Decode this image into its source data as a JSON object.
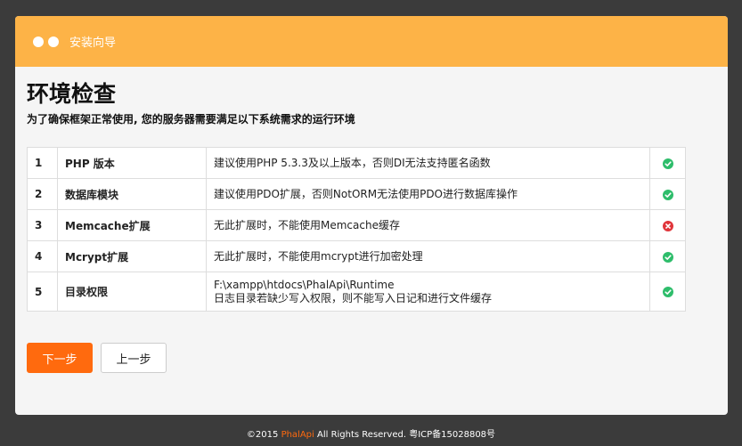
{
  "header": {
    "title": "安装向导"
  },
  "page": {
    "title": "环境检查",
    "subtitle": "为了确保框架正常使用, 您的服务器需要满足以下系统需求的运行环境"
  },
  "checks": [
    {
      "num": "1",
      "name": "PHP 版本",
      "desc": "建议使用PHP 5.3.3及以上版本，否则DI无法支持匿名函数",
      "desc2": "",
      "status": "ok"
    },
    {
      "num": "2",
      "name": "数据库模块",
      "desc": "建议使用PDO扩展，否则NotORM无法使用PDO进行数据库操作",
      "desc2": "",
      "status": "ok"
    },
    {
      "num": "3",
      "name": "Memcache扩展",
      "desc": "无此扩展时，不能使用Memcache缓存",
      "desc2": "",
      "status": "error"
    },
    {
      "num": "4",
      "name": "Mcrypt扩展",
      "desc": "无此扩展时，不能使用mcrypt进行加密处理",
      "desc2": "",
      "status": "ok"
    },
    {
      "num": "5",
      "name": "目录权限",
      "desc": "F:\\xampp\\htdocs\\PhalApi\\Runtime",
      "desc2": "日志目录若缺少写入权限，则不能写入日记和进行文件缓存",
      "status": "ok"
    }
  ],
  "buttons": {
    "next_label": "下一步",
    "prev_label": "上一步"
  },
  "footer": {
    "prefix": "©2015 ",
    "brand": "PhalApi",
    "suffix": " All Rights Reserved. 粤ICP备15028808号"
  },
  "colors": {
    "header_bg": "#fdb347",
    "accent": "#ff6a0e",
    "ok": "#2ebd6b",
    "error": "#e0353b"
  },
  "icons": {
    "ok": "check-circle-icon",
    "error": "x-circle-icon"
  }
}
